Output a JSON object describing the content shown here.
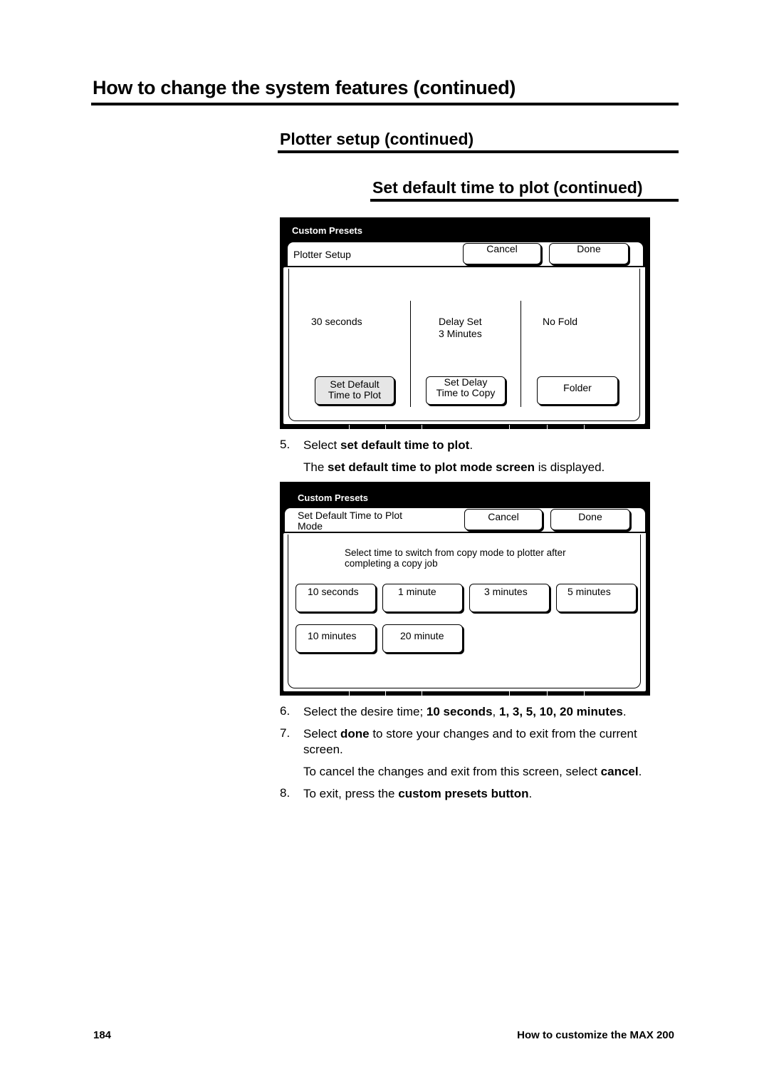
{
  "page": {
    "heading": "How to change the system features (continued)",
    "subheading": "Plotter setup (continued)",
    "section_heading": "Set default time to plot (continued)"
  },
  "screen1": {
    "title": "Custom Presets",
    "tab_label": "Plotter Setup",
    "cancel_label": "Cancel",
    "done_label": "Done",
    "columns": [
      {
        "value": "30 seconds",
        "button": "Set Default\nTime to Plot",
        "selected": true
      },
      {
        "value": "Delay Set\n3 Minutes",
        "button": "Set Delay\nTime to Copy",
        "selected": false
      },
      {
        "value": "No Fold",
        "button": "Folder",
        "selected": false
      }
    ]
  },
  "step5": {
    "number": "5.",
    "prefix": "Select ",
    "bold": "set default time to plot",
    "suffix": ".",
    "note_prefix": "The ",
    "note_bold": "set default time to plot mode screen",
    "note_suffix": " is displayed."
  },
  "screen2": {
    "title": "Custom Presets",
    "tab_label": "Set Default Time to Plot\nMode",
    "cancel_label": "Cancel",
    "done_label": "Done",
    "instruction": "Select time to switch from copy mode to plotter after\ncompleting a copy job",
    "options": [
      "10 seconds",
      "1 minute",
      "3 minutes",
      "5 minutes",
      "10 minutes",
      "20 minute"
    ]
  },
  "step6": {
    "number": "6.",
    "prefix": "Select the desire time; ",
    "bold1": "10 seconds",
    "mid": ", ",
    "bold2": "1, 3, 5, 10, 20 minutes",
    "suffix": "."
  },
  "step7": {
    "number": "7.",
    "prefix": "Select ",
    "bold": "done",
    "suffix": " to store your changes and to exit from the current",
    "line2": "screen.",
    "note_prefix": "To cancel the changes and exit from this screen, select ",
    "note_bold": "cancel",
    "note_suffix": "."
  },
  "step8": {
    "number": "8.",
    "prefix": "To exit, press the ",
    "bold": "custom presets button",
    "suffix": "."
  },
  "footer": {
    "page_number": "184",
    "chapter": "How to customize the MAX 200"
  }
}
